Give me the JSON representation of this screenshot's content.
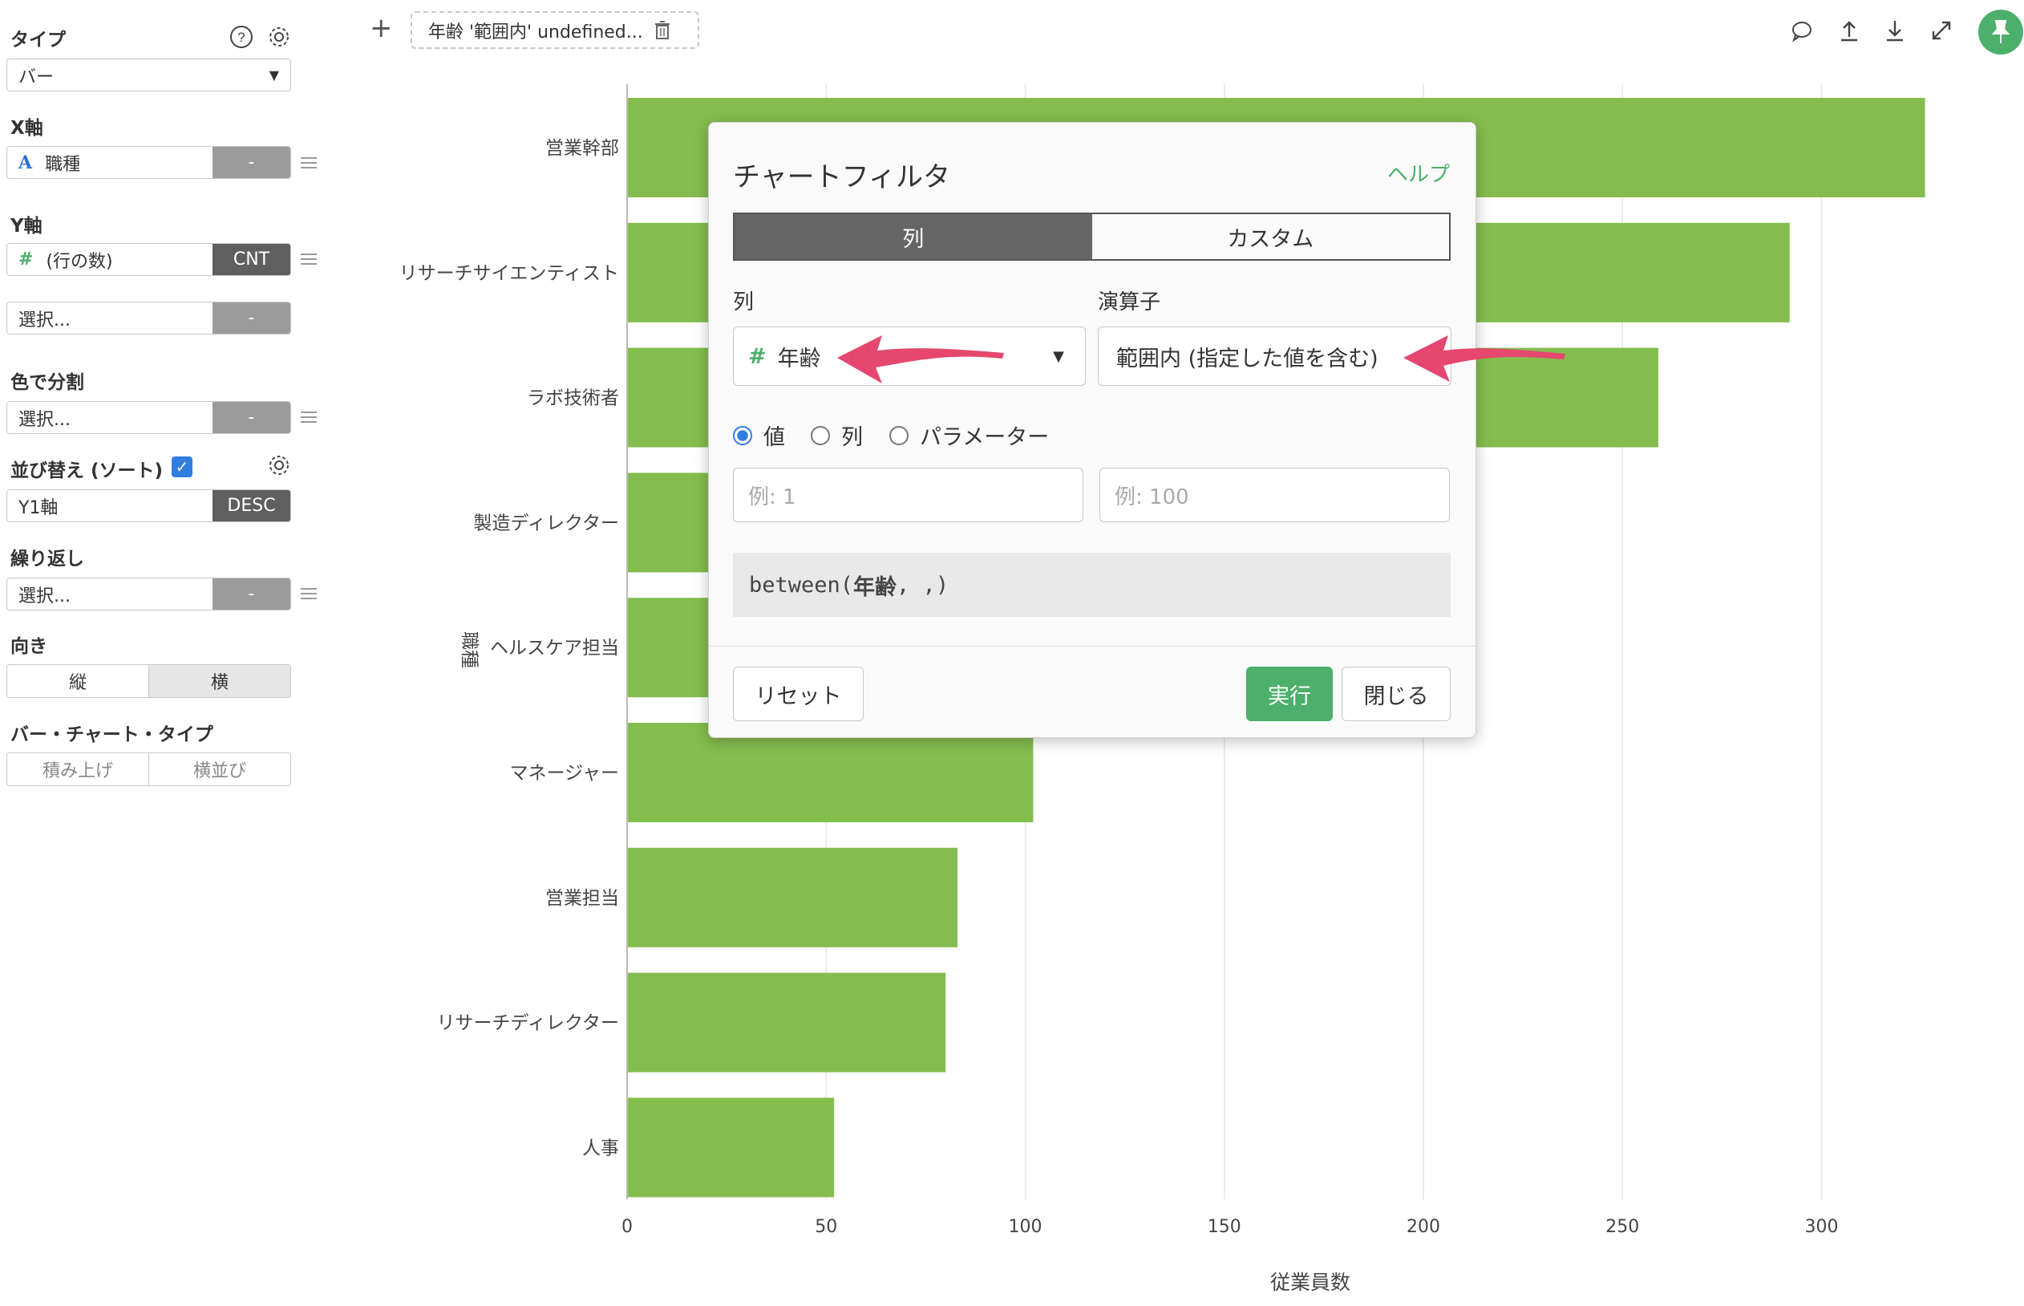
{
  "sidebar": {
    "type_label": "タイプ",
    "type_value": "バー",
    "x_axis_label": "X軸",
    "x_axis_value": "職種",
    "x_axis_agg": "-",
    "y_axis_label": "Y軸",
    "y_axis_value": "(行の数)",
    "y_axis_agg": "CNT",
    "y_axis2_value": "選択...",
    "y_axis2_agg": "-",
    "color_label": "色で分割",
    "color_value": "選択...",
    "color_agg": "-",
    "sort_label": "並び替え (ソート)",
    "sort_value": "Y1軸",
    "sort_order": "DESC",
    "repeat_label": "繰り返し",
    "repeat_value": "選択...",
    "repeat_agg": "-",
    "orientation_label": "向き",
    "orientation_options": [
      "縦",
      "横"
    ],
    "orientation_selected": "横",
    "bar_type_label": "バー・チャート・タイプ",
    "bar_type_options": [
      "積み上げ",
      "横並び"
    ]
  },
  "toolbar": {
    "filter_chip": "年齢 '範囲内' undefined...",
    "icons": [
      "comment-icon",
      "upload-icon",
      "download-icon",
      "expand-icon",
      "pin-icon"
    ]
  },
  "chart_data": {
    "type": "bar",
    "orientation": "horizontal",
    "categories": [
      "営業幹部",
      "リサーチサイエンティスト",
      "ラボ技術者",
      "製造ディレクター",
      "ヘルスケア担当",
      "マネージャー",
      "営業担当",
      "リサーチディレクター",
      "人事"
    ],
    "values": [
      326,
      292,
      259,
      145,
      131,
      102,
      83,
      80,
      52
    ],
    "xlabel": "従業員数",
    "ylabel": "職種",
    "xlim": [
      0,
      330
    ],
    "xticks": [
      0,
      50,
      100,
      150,
      200,
      250,
      300
    ],
    "bar_color": "#84bd4e",
    "grid": true
  },
  "dialog": {
    "title": "チャートフィルタ",
    "help": "ヘルプ",
    "tabs": [
      "列",
      "カスタム"
    ],
    "active_tab": "列",
    "column_label": "列",
    "column_value": "年齢",
    "operator_label": "演算子",
    "operator_value": "範囲内 (指定した値を含む)",
    "radio_options": [
      "値",
      "列",
      "パラメーター"
    ],
    "radio_selected": "値",
    "input1_placeholder": "例: 1",
    "input2_placeholder": "例: 100",
    "expression_prefix": "between(",
    "expression_bold": "年齢",
    "expression_suffix": ", ,)",
    "reset_label": "リセット",
    "run_label": "実行",
    "close_label": "閉じる"
  },
  "colors": {
    "accent": "#4caf6b",
    "bar": "#84bd4e",
    "annotation_arrow": "#e5476e"
  }
}
